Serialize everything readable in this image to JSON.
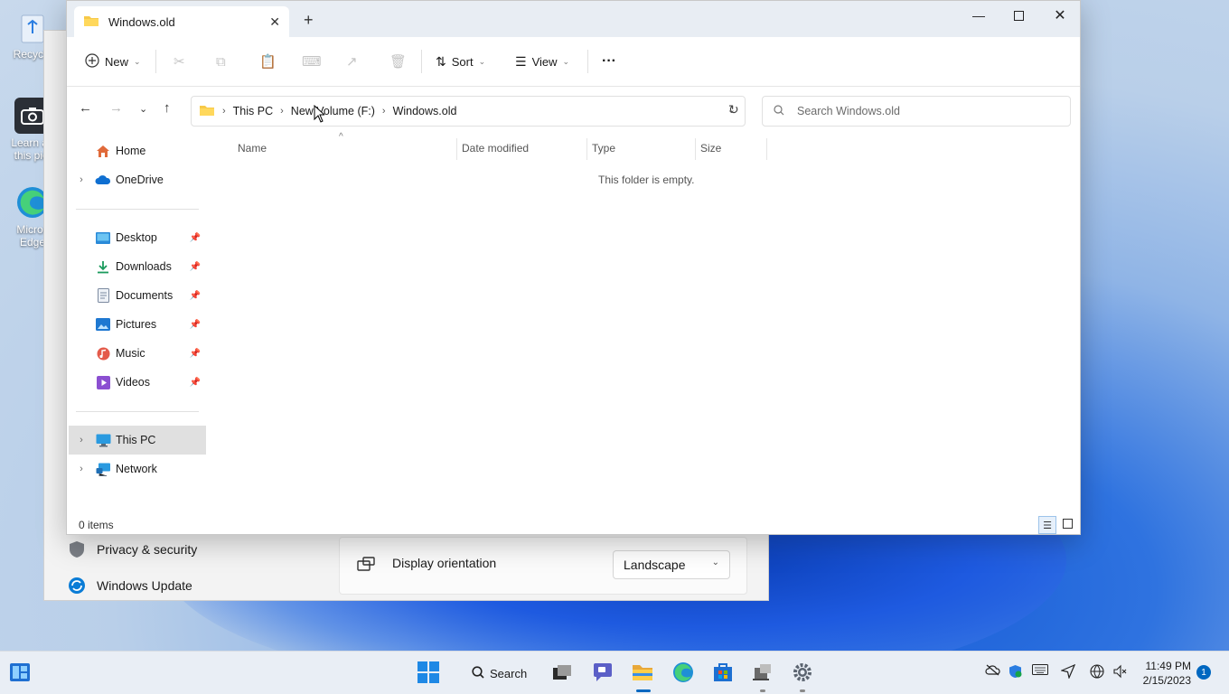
{
  "desktop": {
    "icons": [
      {
        "label": "Recycle"
      },
      {
        "label": "Learn ab this pict"
      },
      {
        "label": "Micros Edge"
      }
    ]
  },
  "settings": {
    "nav": [
      {
        "label": "Privacy & security"
      },
      {
        "label": "Windows Update"
      }
    ],
    "display_orientation": {
      "label": "Display orientation",
      "value": "Landscape"
    }
  },
  "explorer": {
    "tab_title": "Windows.old",
    "toolbar": {
      "new_label": "New",
      "sort_label": "Sort",
      "view_label": "View",
      "more_label": "···"
    },
    "breadcrumb": [
      "This PC",
      "New Volume (F:)",
      "Windows.old"
    ],
    "search_placeholder": "Search Windows.old",
    "sidebar": {
      "top": [
        {
          "label": "Home"
        },
        {
          "label": "OneDrive"
        }
      ],
      "quick": [
        {
          "label": "Desktop"
        },
        {
          "label": "Downloads"
        },
        {
          "label": "Documents"
        },
        {
          "label": "Pictures"
        },
        {
          "label": "Music"
        },
        {
          "label": "Videos"
        }
      ],
      "bottom": [
        {
          "label": "This PC"
        },
        {
          "label": "Network"
        }
      ]
    },
    "columns": [
      "Name",
      "Date modified",
      "Type",
      "Size"
    ],
    "empty_message": "This folder is empty.",
    "status": "0 items"
  },
  "taskbar": {
    "search_label": "Search",
    "time": "11:49 PM",
    "date": "2/15/2023",
    "notification_count": "1"
  }
}
